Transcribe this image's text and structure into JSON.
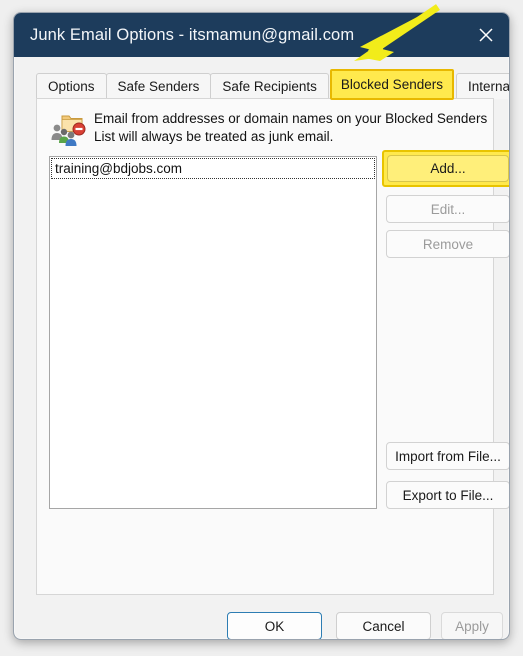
{
  "window": {
    "title": "Junk Email Options - itsmamun@gmail.com",
    "close_icon": "close-icon",
    "titlebar_color": "#1d3c5c"
  },
  "tabs": [
    {
      "label": "Options",
      "state": "inactive",
      "highlighted": false
    },
    {
      "label": "Safe Senders",
      "state": "inactive",
      "highlighted": false
    },
    {
      "label": "Safe Recipients",
      "state": "inactive",
      "highlighted": false
    },
    {
      "label": "Blocked Senders",
      "state": "active",
      "highlighted": true
    },
    {
      "label": "International",
      "state": "inactive",
      "highlighted": false
    }
  ],
  "panel": {
    "icon": "blocked-senders-icon",
    "description": "Email from addresses or domain names on your Blocked Senders List will always be treated as junk email.",
    "list": {
      "items": [
        {
          "value": "training@bdjobs.com",
          "focused": true
        }
      ]
    },
    "buttons": {
      "add": {
        "label": "Add...",
        "enabled": true,
        "highlighted": true
      },
      "edit": {
        "label": "Edit...",
        "enabled": false,
        "highlighted": false
      },
      "remove": {
        "label": "Remove",
        "enabled": false,
        "highlighted": false
      },
      "import": {
        "label": "Import from File...",
        "enabled": true,
        "highlighted": false
      },
      "export": {
        "label": "Export to File...",
        "enabled": true,
        "highlighted": false
      }
    }
  },
  "footer": {
    "ok": {
      "label": "OK",
      "enabled": true,
      "focused": true
    },
    "cancel": {
      "label": "Cancel",
      "enabled": true,
      "focused": false
    },
    "apply": {
      "label": "Apply",
      "enabled": false,
      "focused": false
    }
  },
  "annotations": {
    "arrow": {
      "name": "yellow-arrow-annotation",
      "color": "#f2ec1a",
      "points_to": "Blocked Senders"
    }
  },
  "colors": {
    "highlight_yellow": "#ffe94d",
    "highlight_border": "#e8c400",
    "focus_blue": "#2d7db3",
    "disabled_text": "#9b9b9b"
  }
}
